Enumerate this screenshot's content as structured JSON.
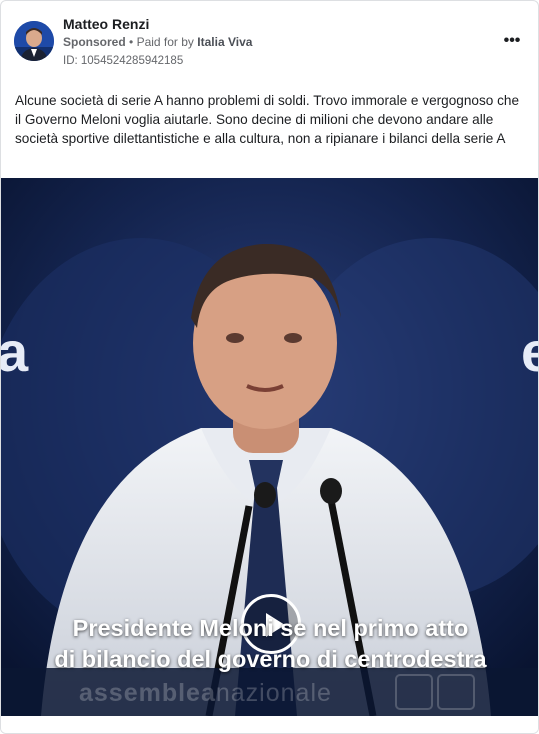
{
  "post": {
    "author": "Matteo Renzi",
    "sponsored_label": "Sponsored",
    "paid_for_prefix": "Paid for by",
    "advertiser": "Italia Viva",
    "ad_id": "ID: 1054524285942185",
    "more_icon": "more-horizontal-icon",
    "more_glyph": "•••",
    "body_text": "Alcune società di serie A hanno problemi di soldi. Trovo immorale e vergognoso che il Governo Meloni voglia aiutarle. Sono decine di milioni che devono andare alle società sportive dilettantistiche e alla cultura, non a ripianare i bilanci della serie A"
  },
  "video": {
    "caption_line1": "Presidente Meloni se nel primo atto",
    "caption_line2": "di bilancio del governo di centrodestra",
    "stage_text_bold": "assemblea",
    "stage_text_light": "nazionale",
    "play_icon": "play-icon"
  },
  "colors": {
    "text_primary": "#1c1e21",
    "text_secondary": "#65676b",
    "video_bg": "#0d1a36"
  }
}
